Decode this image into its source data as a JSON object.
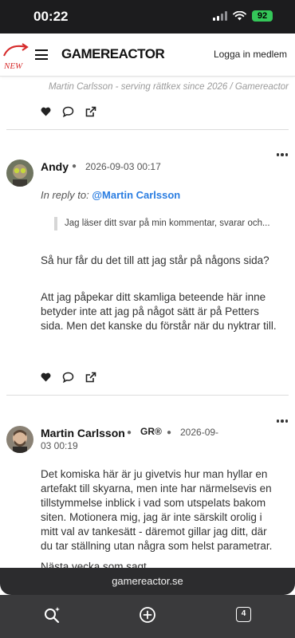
{
  "status_bar": {
    "time": "00:22",
    "battery": "92"
  },
  "header": {
    "badge": "NEW",
    "logo": "GAMEREACTOR",
    "login_label": "Logga in medlem"
  },
  "signature": "Martin Carlsson - serving rättkex since 2026 / Gamereactor",
  "comments": [
    {
      "author": "Andy",
      "timestamp": "2026-09-03 00:17",
      "reply_label": "In reply to:",
      "reply_mention": "@Martin Carlsson",
      "quote": "Jag läser ditt svar på min kommentar, svarar och...",
      "paragraphs": [
        "Så hur får du det till att jag står på någons sida?",
        "Att jag påpekar ditt skamliga beteende här inne betyder inte att jag på något sätt är på Petters sida. Men det kanske du förstår när du nyktrar till."
      ]
    },
    {
      "author": "Martin Carlsson",
      "badge": "GR®",
      "timestamp_line1": "2026-09-",
      "timestamp_line2": "03 00:19",
      "paragraphs": [
        "Det komiska här är ju givetvis hur man hyllar en artefakt till skyarna, men inte har närmelsevis en tillstymmelse inblick i vad som utspelats bakom siten. Motionera mig, jag är inte särskilt orolig i mitt val av tankesätt - däremot gillar jag ditt, där du tar ställning utan några som helst parametrar.",
        "Nästa vecka som sagt"
      ]
    }
  ],
  "url_bar": {
    "domain": "gamereactor.se"
  },
  "toolbar": {
    "tab_count": "4"
  },
  "colors": {
    "accent": "#2a7de1",
    "battery": "#34c759",
    "toolbar": "#3a3a3c"
  }
}
